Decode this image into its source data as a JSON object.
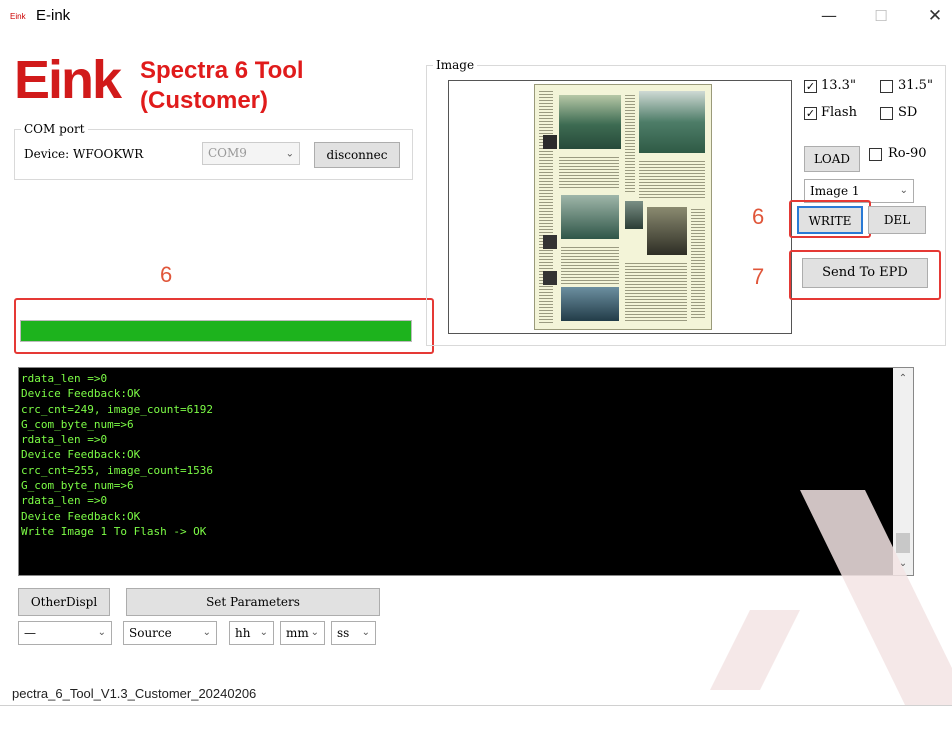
{
  "window": {
    "icon_text": "Eink",
    "title": "E-ink",
    "controls": {
      "minimize": "—",
      "maximize": "☐",
      "close": "✕"
    }
  },
  "logo": {
    "mark": "Eink",
    "line1": "Spectra 6 Tool",
    "line2": "(Customer)"
  },
  "com_port": {
    "legend": "COM port",
    "device_label": "Device: WFOOKWR",
    "port_value": "COM9",
    "disconnect_label": "disconnec"
  },
  "progress": {
    "value": 1.0,
    "color": "#1db31d"
  },
  "image_panel": {
    "legend": "Image"
  },
  "options": {
    "size_13": {
      "label": "13.3\"",
      "checked": true
    },
    "size_31": {
      "label": "31.5\"",
      "checked": false
    },
    "flash": {
      "label": "Flash",
      "checked": true
    },
    "sd": {
      "label": "SD",
      "checked": false
    },
    "load_label": "LOAD",
    "rotate": {
      "label": "Ro-90",
      "checked": false
    },
    "image_select": "Image 1",
    "write_label": "WRITE",
    "del_label": "DEL",
    "send_label": "Send To EPD"
  },
  "annotations": {
    "progress_num": "6",
    "write_num": "6",
    "send_num": "7",
    "color": "#e53935"
  },
  "console": {
    "lines": [
      "rdata_len =>0",
      "Device Feedback:OK",
      "crc_cnt=249, image_count=6192",
      "G_com_byte_num=>6",
      "rdata_len =>0",
      "Device Feedback:OK",
      "crc_cnt=255, image_count=1536",
      "G_com_byte_num=>6",
      "rdata_len =>0",
      "Device Feedback:OK",
      "Write Image 1 To Flash -> OK"
    ],
    "text_color": "#7cfc46"
  },
  "bottom": {
    "other_display_label": "OtherDispl",
    "set_parameters_label": "Set Parameters",
    "selects": {
      "first": "—",
      "source": "Source",
      "hh": "hh",
      "mm": "mm",
      "ss": "ss"
    }
  },
  "footer": {
    "version": "pectra_6_Tool_V1.3_Customer_20240206"
  }
}
